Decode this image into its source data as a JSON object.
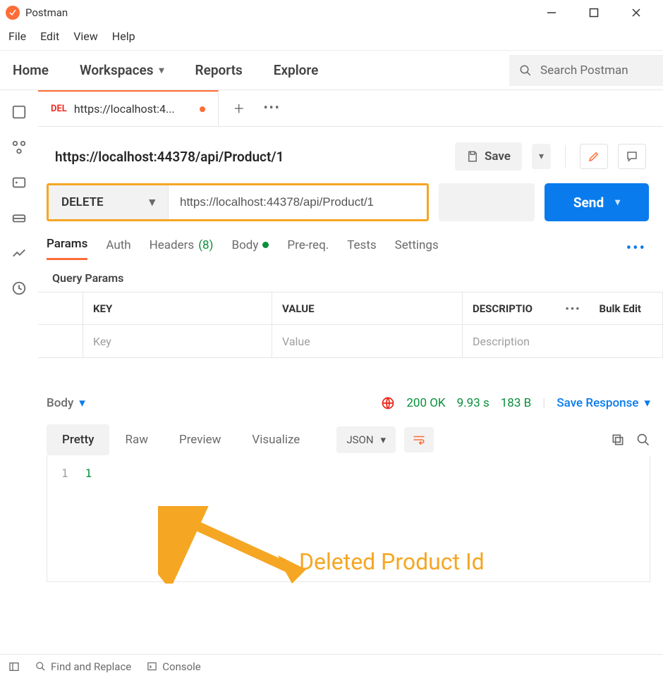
{
  "window": {
    "title": "Postman"
  },
  "menubar": [
    "File",
    "Edit",
    "View",
    "Help"
  ],
  "topnav": {
    "home": "Home",
    "workspaces": "Workspaces",
    "reports": "Reports",
    "explore": "Explore",
    "search_placeholder": "Search Postman"
  },
  "tab": {
    "method_short": "DEL",
    "title": "https://localhost:4..."
  },
  "request": {
    "title": "https://localhost:44378/api/Product/1",
    "save_label": "Save",
    "method": "DELETE",
    "url": "https://localhost:44378/api/Product/1",
    "send_label": "Send"
  },
  "reqtabs": {
    "params": "Params",
    "auth": "Auth",
    "headers": "Headers",
    "headers_count": "(8)",
    "body": "Body",
    "prereq": "Pre-req.",
    "tests": "Tests",
    "settings": "Settings"
  },
  "query": {
    "heading": "Query Params",
    "col_key": "KEY",
    "col_value": "VALUE",
    "col_desc": "DESCRIPTIO",
    "bulk": "Bulk Edit",
    "ph_key": "Key",
    "ph_value": "Value",
    "ph_desc": "Description"
  },
  "response": {
    "section_label": "Body",
    "status": "200 OK",
    "time": "9.93 s",
    "size": "183 B",
    "save": "Save Response",
    "tabs": {
      "pretty": "Pretty",
      "raw": "Raw",
      "preview": "Preview",
      "visualize": "Visualize"
    },
    "format": "JSON",
    "line_no": "1",
    "body_value": "1"
  },
  "annotation": "Deleted Product Id",
  "footer": {
    "find": "Find and Replace",
    "console": "Console"
  }
}
